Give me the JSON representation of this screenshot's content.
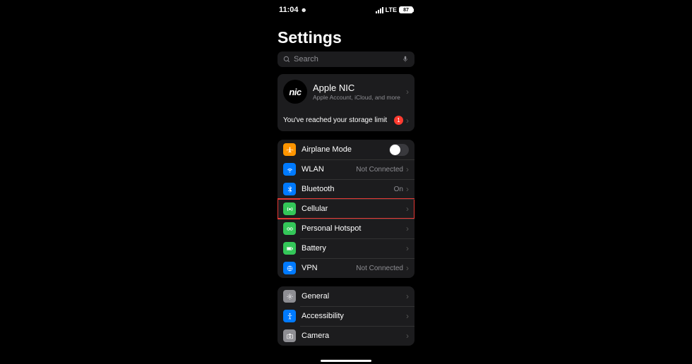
{
  "status": {
    "time": "11:04",
    "network": "LTE",
    "battery": "87"
  },
  "header": {
    "title": "Settings"
  },
  "search": {
    "placeholder": "Search"
  },
  "profile": {
    "avatar_text": "nic",
    "name": "Apple  NIC",
    "sub": "Apple Account, iCloud, and more",
    "storage_msg": "You've reached your storage limit",
    "badge": "1"
  },
  "group1": {
    "airplane": "Airplane Mode",
    "wlan": "WLAN",
    "wlan_value": "Not Connected",
    "bluetooth": "Bluetooth",
    "bluetooth_value": "On",
    "cellular": "Cellular",
    "hotspot": "Personal Hotspot",
    "battery": "Battery",
    "vpn": "VPN",
    "vpn_value": "Not Connected"
  },
  "group2": {
    "general": "General",
    "accessibility": "Accessibility",
    "camera": "Camera"
  }
}
